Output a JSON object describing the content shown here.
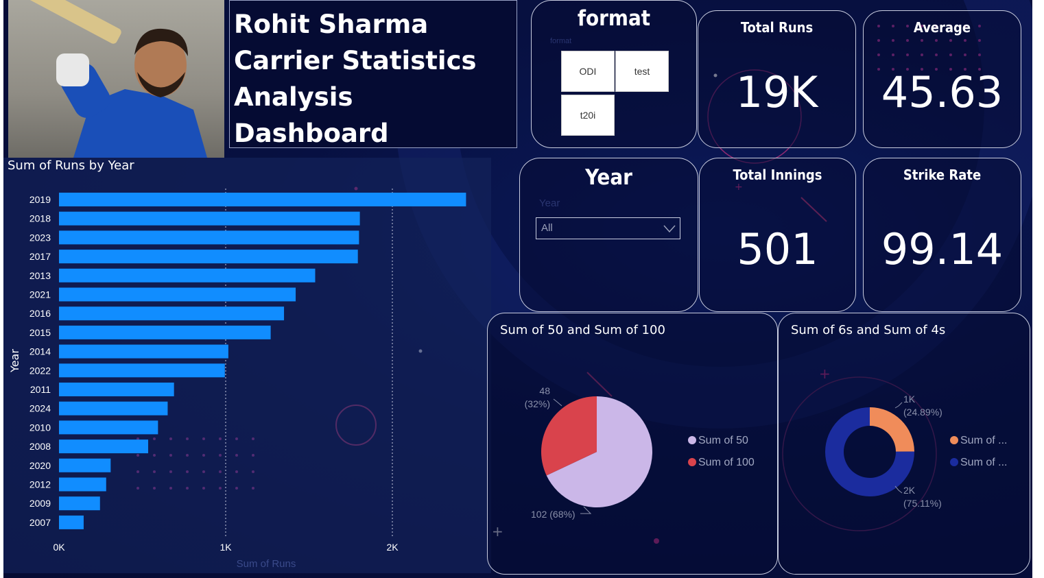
{
  "title": "Rohit Sharma Carrier Statistics Analysis Dashboard",
  "format_slicer": {
    "heading": "format",
    "sub_label": "format",
    "options": [
      "ODI",
      "test",
      "t20i"
    ]
  },
  "year_slicer": {
    "heading": "Year",
    "sub_label": "Year",
    "selected": "All"
  },
  "kpis": {
    "total_runs": {
      "label": "Total Runs",
      "value": "19K"
    },
    "average": {
      "label": "Average",
      "value": "45.63"
    },
    "total_innings": {
      "label": "Total Innings",
      "value": "501"
    },
    "strike_rate": {
      "label": "Strike Rate",
      "value": "99.14"
    }
  },
  "colors": {
    "bar": "#118DFF",
    "fifty": "#CBB7E8",
    "hundred": "#D9434C",
    "sixes": "#F08C5A",
    "fours": "#1B2C9E",
    "accent_pink": "#E0348F"
  },
  "chart_data": [
    {
      "type": "bar",
      "orientation": "horizontal",
      "title": "Sum of Runs by Year",
      "xlabel": "Sum of Runs",
      "ylabel": "Year",
      "xlim": [
        0,
        2500
      ],
      "xticks": [
        "0K",
        "1K",
        "2K"
      ],
      "categories": [
        "2019",
        "2018",
        "2023",
        "2017",
        "2013",
        "2021",
        "2016",
        "2015",
        "2014",
        "2022",
        "2011",
        "2024",
        "2010",
        "2008",
        "2020",
        "2012",
        "2009",
        "2007"
      ],
      "values": [
        2442,
        1805,
        1800,
        1793,
        1537,
        1420,
        1350,
        1270,
        1016,
        995,
        690,
        652,
        594,
        535,
        310,
        283,
        246,
        148
      ],
      "grid": "vertical dotted"
    },
    {
      "type": "pie",
      "title": "Sum of 50 and Sum of 100",
      "labels": [
        "Sum of 50",
        "Sum of 100"
      ],
      "values": [
        102,
        48
      ],
      "percent_labels": [
        "102 (68%)",
        "48\n(32%)"
      ],
      "legend": "right"
    },
    {
      "type": "pie",
      "subtype": "donut",
      "title": "Sum of 6s and Sum of 4s",
      "labels": [
        "Sum of ...",
        "Sum of ..."
      ],
      "values": [
        24.89,
        75.11
      ],
      "value_labels": [
        "1K",
        "2K"
      ],
      "percent_labels": [
        "(24.89%)",
        "(75.11%)"
      ],
      "legend": "right"
    }
  ]
}
